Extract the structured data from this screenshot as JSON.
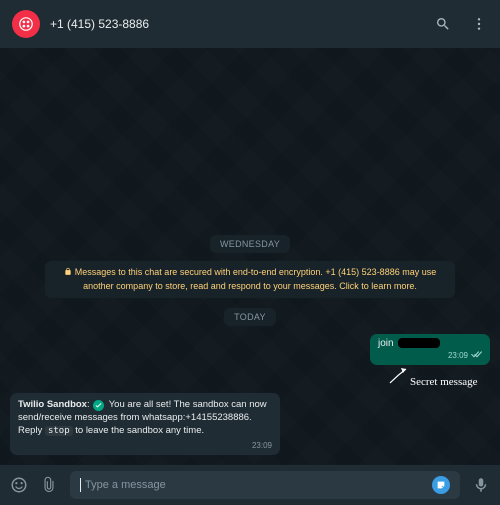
{
  "header": {
    "contact_name": "+1 (415) 523-8886"
  },
  "chat": {
    "day_label_1": "WEDNESDAY",
    "encryption_notice": "Messages to this chat are secured with end-to-end encryption. +1 (415) 523-8886 may use another company to store, read and respond to your messages. Click to learn more.",
    "day_label_2": "TODAY",
    "outgoing": {
      "text_prefix": "join",
      "time": "23:09",
      "annotation": "Secret message"
    },
    "incoming": {
      "sender": "Twilio Sandbox",
      "sender_suffix": ":",
      "text_before_code": " You are all set! The sandbox can now send/receive messages from whatsapp:+14155238886. Reply ",
      "code": "stop",
      "text_after_code": " to leave the sandbox any time.",
      "time": "23:09"
    }
  },
  "composer": {
    "placeholder": "Type a message"
  }
}
